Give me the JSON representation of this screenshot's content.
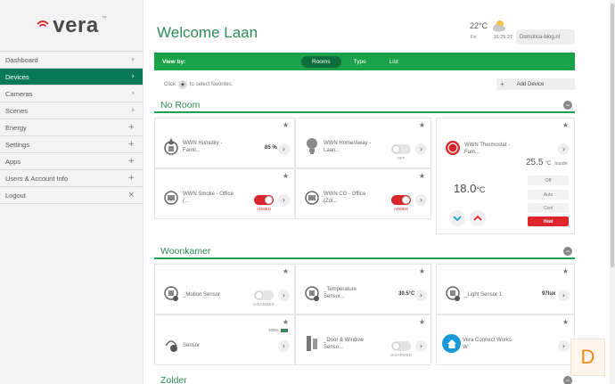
{
  "brand": {
    "logo_text": "vera",
    "logo_tm": "™"
  },
  "sidebar": {
    "items": [
      {
        "label": "Dashboard",
        "indicator": "›"
      },
      {
        "label": "Devices",
        "indicator": "›",
        "active": true
      },
      {
        "label": "Cameras",
        "indicator": "›"
      },
      {
        "label": "Scenes",
        "indicator": "›"
      },
      {
        "label": "Energy",
        "indicator": "+"
      },
      {
        "label": "Settings",
        "indicator": "+"
      },
      {
        "label": "Apps",
        "indicator": "+"
      },
      {
        "label": "Users & Account Info",
        "indicator": "+"
      },
      {
        "label": "Logout",
        "indicator": "×"
      }
    ]
  },
  "header": {
    "title": "Welcome Laan",
    "temperature": "22°C",
    "day": "Fri",
    "time": "16:25:27",
    "site": "Domotica-blog.nl",
    "weather_icon": "partly-cloudy-icon"
  },
  "viewbar": {
    "label": "View by:",
    "tabs": [
      {
        "label": "Rooms",
        "selected": true
      },
      {
        "label": "Type"
      },
      {
        "label": "List"
      }
    ]
  },
  "favorites_hint": {
    "click": "Click",
    "star": "★",
    "text": "to select favorites."
  },
  "add_device": {
    "plus": "+",
    "label": "Add Device"
  },
  "rooms": {
    "no_room": {
      "name": "No Room",
      "collapse": "−",
      "devices": {
        "humidity": {
          "name": "WWN Humidity - Famil...",
          "value": "65 %"
        },
        "home_away": {
          "name": "WWN Home/Away - Laan...",
          "state": "OFF"
        },
        "smoke": {
          "name": "WWN Smoke - Office (...",
          "state": "ARMED"
        },
        "co": {
          "name": "WWN CO - Office (Zol...",
          "state": "ARMED"
        },
        "thermostat": {
          "name": "WWN Thermostat - Fam...",
          "current": "25.5",
          "current_unit": "°C",
          "inside": "Inside",
          "setpoint": "18.0",
          "setpoint_unit": "°C",
          "modes": [
            "Off",
            "Auto",
            "Cool",
            "Heat"
          ],
          "active_mode": "Heat",
          "down": "⌄",
          "up": "⌃"
        }
      }
    },
    "woonkamer": {
      "name": "Woonkamer",
      "collapse": "−",
      "devices": {
        "motion": {
          "name": "_Motion Sensor",
          "state": "DISARMED"
        },
        "temperature": {
          "name": "_Temperature Sensor...",
          "value": "30.5°C"
        },
        "light": {
          "name": "_Light Sensor 1",
          "value": "97lux"
        },
        "sensor": {
          "name": "Sensor",
          "battery": "100%",
          "battery_level": 1.0
        },
        "door": {
          "name": "_Door & Window Senso...",
          "state": "DISARMED"
        },
        "vera_connect": {
          "name": "Vera Connect Works W"
        }
      }
    },
    "zolder": {
      "name": "Zolder",
      "collapse": "−"
    }
  },
  "common": {
    "star": "★",
    "arrow": "›"
  },
  "watermark": {
    "letter": "D"
  },
  "colors": {
    "accent": "#1aa24a",
    "active_nav": "#06785a",
    "heat": "#e0262d",
    "armed": "#d9262a"
  }
}
